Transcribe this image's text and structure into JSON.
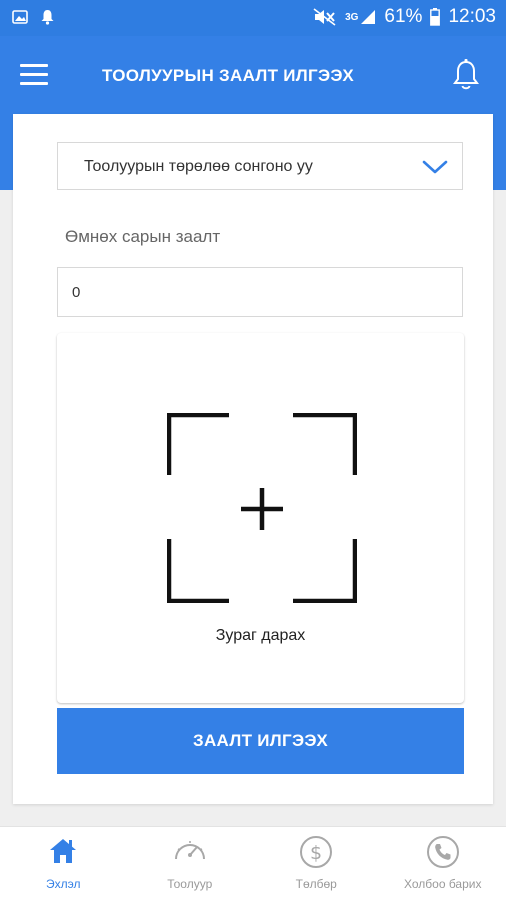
{
  "status_bar": {
    "network": "3G",
    "battery": "61%",
    "time": "12:03"
  },
  "app_bar": {
    "title": "ТООЛУУРЫН ЗААЛТ ИЛГЭЭХ"
  },
  "form": {
    "meter_type_select": {
      "selected_value": "Тоолуурын төрөлөө сонгоно уу"
    },
    "previous_reading_label": "Өмнөх сарын заалт",
    "previous_reading_value": "0",
    "photo_caption": "Зураг дарах",
    "submit_label": "ЗААЛТ ИЛГЭЭХ"
  },
  "bottom_nav": {
    "items": [
      {
        "label": "Эхлэл",
        "icon": "home-icon",
        "active": true
      },
      {
        "label": "Тоолуур",
        "icon": "speedometer-icon",
        "active": false
      },
      {
        "label": "Төлбөр",
        "icon": "dollar-icon",
        "active": false
      },
      {
        "label": "Холбоо барих",
        "icon": "phone-icon",
        "active": false
      }
    ]
  },
  "colors": {
    "primary": "#3480e6",
    "status_bar": "#2f7de1",
    "inactive": "#9a9a9a"
  }
}
